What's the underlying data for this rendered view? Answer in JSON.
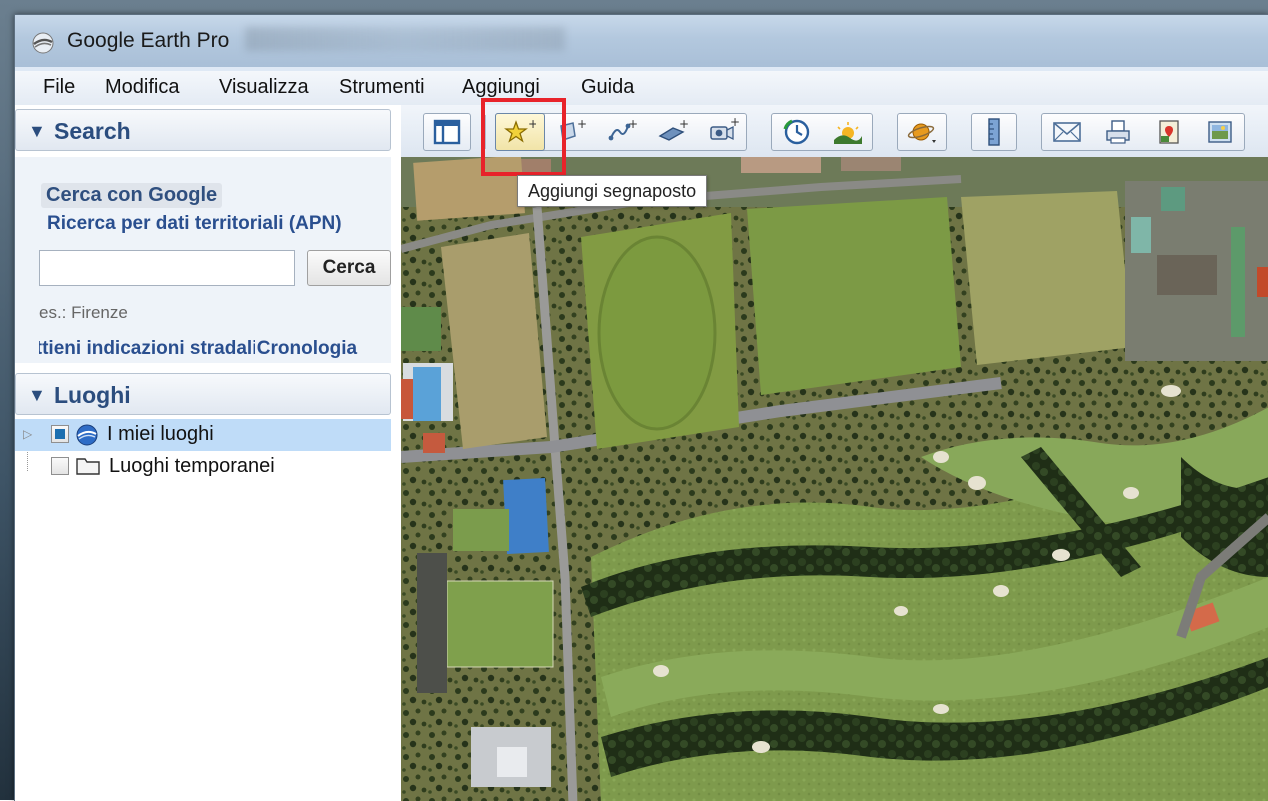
{
  "window": {
    "title": "Google Earth Pro"
  },
  "menu": [
    {
      "label": "File"
    },
    {
      "label": "Modifica"
    },
    {
      "label": "Visualizza"
    },
    {
      "label": "Strumenti"
    },
    {
      "label": "Aggiungi"
    },
    {
      "label": "Guida"
    }
  ],
  "toolbar": {
    "buttons": [
      {
        "icon": "sidebar-toggle-icon"
      },
      {
        "icon": "add-placemark-icon"
      },
      {
        "icon": "add-polygon-icon"
      },
      {
        "icon": "add-path-icon"
      },
      {
        "icon": "add-image-overlay-icon"
      },
      {
        "icon": "record-tour-icon"
      },
      {
        "icon": "historical-imagery-icon"
      },
      {
        "icon": "sunlight-icon"
      },
      {
        "icon": "switch-planet-icon"
      },
      {
        "icon": "ruler-icon"
      },
      {
        "icon": "email-icon"
      },
      {
        "icon": "print-icon"
      },
      {
        "icon": "view-in-google-maps-icon"
      },
      {
        "icon": "save-image-icon"
      }
    ],
    "tooltip": "Aggiungi segnaposto"
  },
  "search": {
    "header": "Search",
    "tab_active": "Cerca con Google",
    "tab_secondary": "Ricerca per dati territoriali (APN)",
    "input_value": "",
    "button_label": "Cerca",
    "hint": "es.: Firenze",
    "link_directions": "Ottieni indicazioni stradali",
    "link_history": "Cronologia"
  },
  "places": {
    "header": "Luoghi",
    "items": [
      {
        "label": "I miei luoghi",
        "checked": true,
        "selected": true
      },
      {
        "label": "Luoghi temporanei",
        "checked": false,
        "selected": false
      }
    ]
  },
  "colors": {
    "accent": "#2b4d7e",
    "highlight": "#e8232a",
    "selection": "#bfdcf8"
  }
}
